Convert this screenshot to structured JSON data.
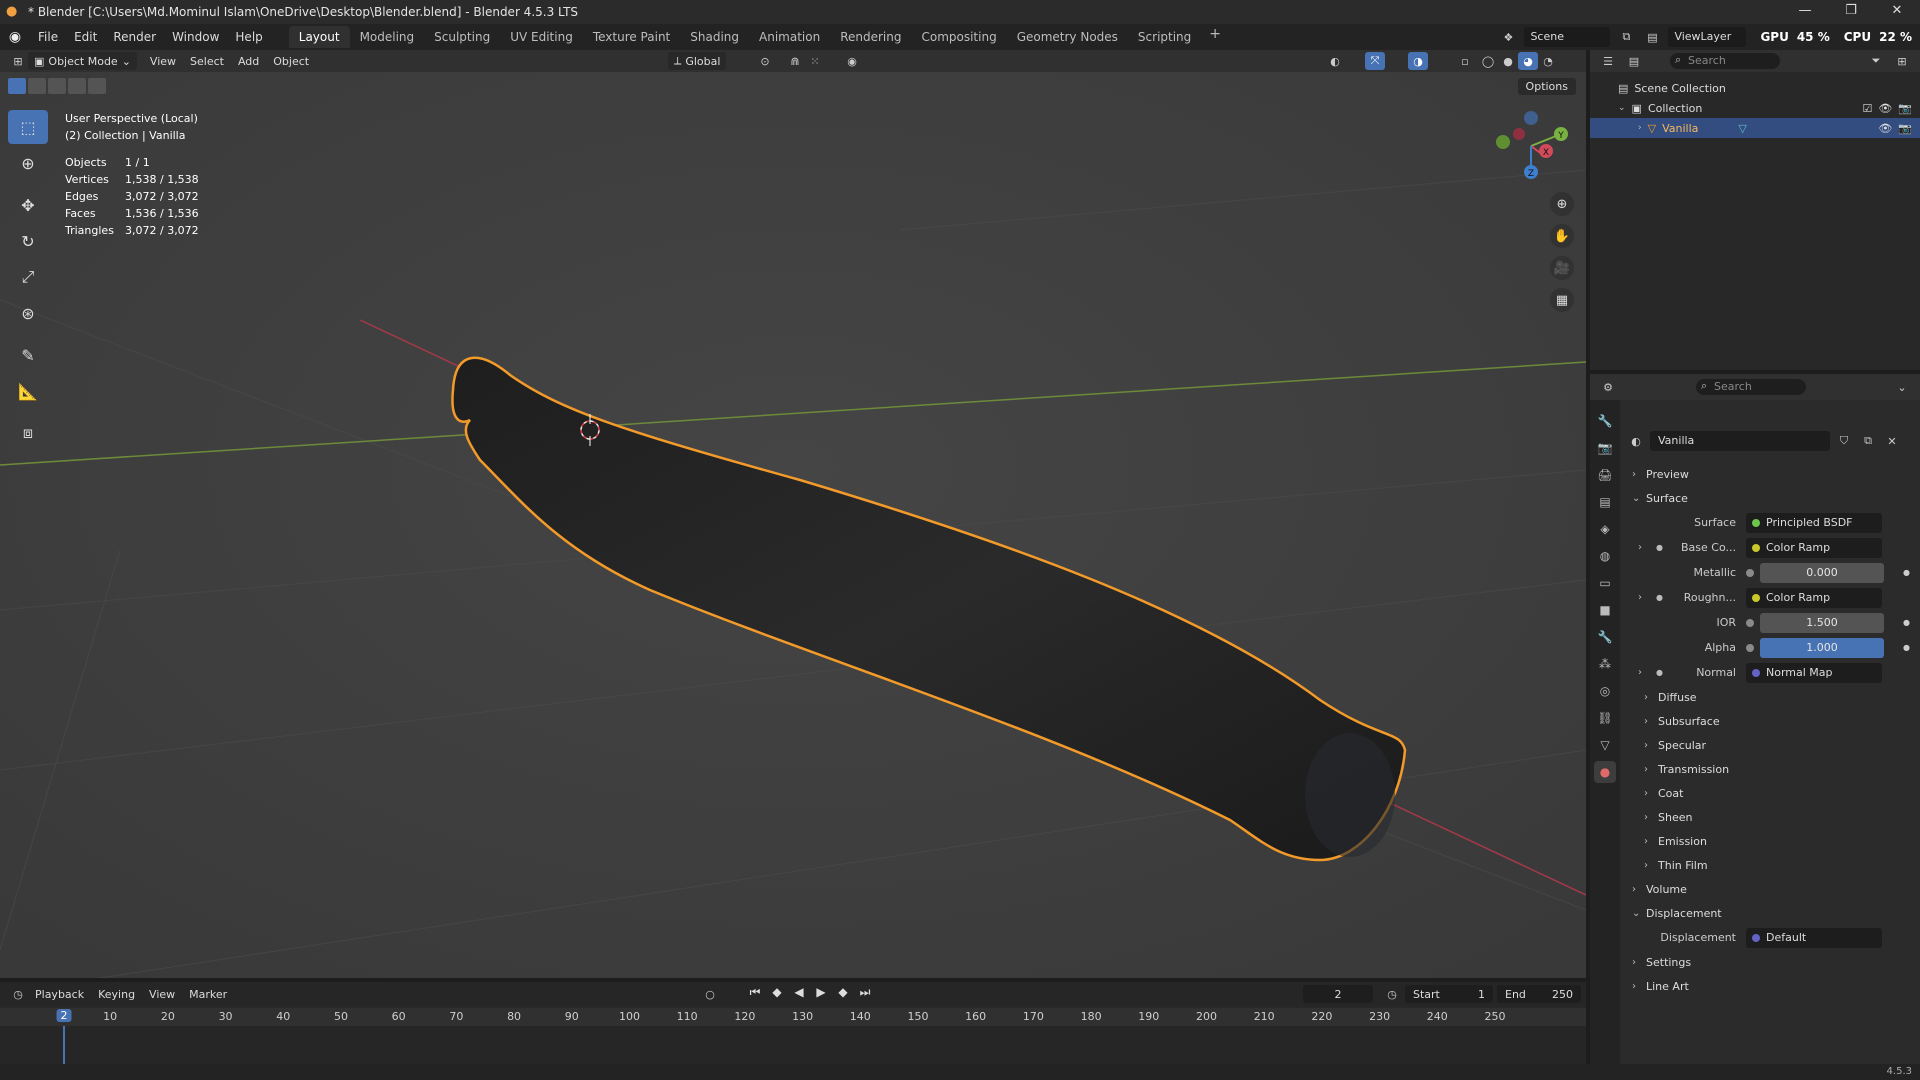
{
  "window": {
    "title": "* Blender [C:\\Users\\Md.Mominul Islam\\OneDrive\\Desktop\\Blender.blend] - Blender 4.5.3 LTS",
    "controls": [
      "—",
      "❐",
      "✕"
    ]
  },
  "menubar": {
    "items": [
      "File",
      "Edit",
      "Render",
      "Window",
      "Help"
    ],
    "workspaces": [
      "Layout",
      "Modeling",
      "Sculpting",
      "UV Editing",
      "Texture Paint",
      "Shading",
      "Animation",
      "Rendering",
      "Compositing",
      "Geometry Nodes",
      "Scripting"
    ],
    "active_workspace": "Layout",
    "add_workspace": "+",
    "scene_label": "Scene",
    "view_layer_label": "ViewLayer",
    "gpu_label": "GPU",
    "gpu_value": "45 %",
    "cpu_label": "CPU",
    "cpu_value": "22 %"
  },
  "viewport": {
    "mode": "Object Mode",
    "menus": [
      "View",
      "Select",
      "Add",
      "Object"
    ],
    "orientation": "Global",
    "options_label": "Options",
    "view_name": "User Perspective (Local)",
    "collection_line": "(2) Collection | Vanilla",
    "stats": [
      {
        "label": "Objects",
        "value": "1 / 1"
      },
      {
        "label": "Vertices",
        "value": "1,538 / 1,538"
      },
      {
        "label": "Edges",
        "value": "3,072 / 3,072"
      },
      {
        "label": "Faces",
        "value": "1,536 / 1,536"
      },
      {
        "label": "Triangles",
        "value": "3,072 / 3,072"
      }
    ],
    "gizmo_axes": {
      "x": "X",
      "y": "Y",
      "z": "Z"
    },
    "colors": {
      "x_axis": "#d34a5a",
      "y_axis": "#7ab241",
      "z_axis": "#3f7fcf",
      "selection": "#f39b2a",
      "active": "#4772b3"
    }
  },
  "timeline": {
    "menus": [
      "Playback",
      "Keying",
      "View",
      "Marker"
    ],
    "current_frame": "2",
    "start_label": "Start",
    "start_value": "1",
    "end_label": "End",
    "end_value": "250",
    "ticks": [
      "10",
      "20",
      "30",
      "40",
      "50",
      "60",
      "70",
      "80",
      "90",
      "100",
      "110",
      "120",
      "130",
      "140",
      "150",
      "160",
      "170",
      "180",
      "190",
      "200",
      "210",
      "220",
      "230",
      "240",
      "250"
    ],
    "playhead_label": "2"
  },
  "outliner": {
    "search_placeholder": "Search",
    "rows": [
      {
        "label": "Scene Collection"
      },
      {
        "label": "Collection"
      },
      {
        "label": "Vanilla"
      }
    ]
  },
  "properties": {
    "search_placeholder": "Search",
    "material_name": "Vanilla",
    "sections": {
      "preview": "Preview",
      "surface": "Surface",
      "volume": "Volume",
      "displacement": "Displacement",
      "settings": "Settings",
      "line_art": "Line Art"
    },
    "surface_rows": [
      {
        "label": "Surface",
        "value": "Principled BSDF",
        "socket": "#6cc74a"
      },
      {
        "label": "Base Co...",
        "value": "Color Ramp",
        "socket": "#c7c729"
      },
      {
        "label": "Metallic",
        "value": "0.000"
      },
      {
        "label": "Roughn...",
        "value": "Color Ramp",
        "socket": "#c7c729"
      },
      {
        "label": "IOR",
        "value": "1.500"
      },
      {
        "label": "Alpha",
        "value": "1.000"
      },
      {
        "label": "Normal",
        "value": "Normal Map",
        "socket": "#6363c7"
      }
    ],
    "subpanels": [
      "Diffuse",
      "Subsurface",
      "Specular",
      "Transmission",
      "Coat",
      "Sheen",
      "Emission",
      "Thin Film"
    ],
    "displacement_row": {
      "label": "Displacement",
      "value": "Default",
      "socket": "#6363c7"
    }
  },
  "statusbar": {
    "version": "4.5.3"
  }
}
